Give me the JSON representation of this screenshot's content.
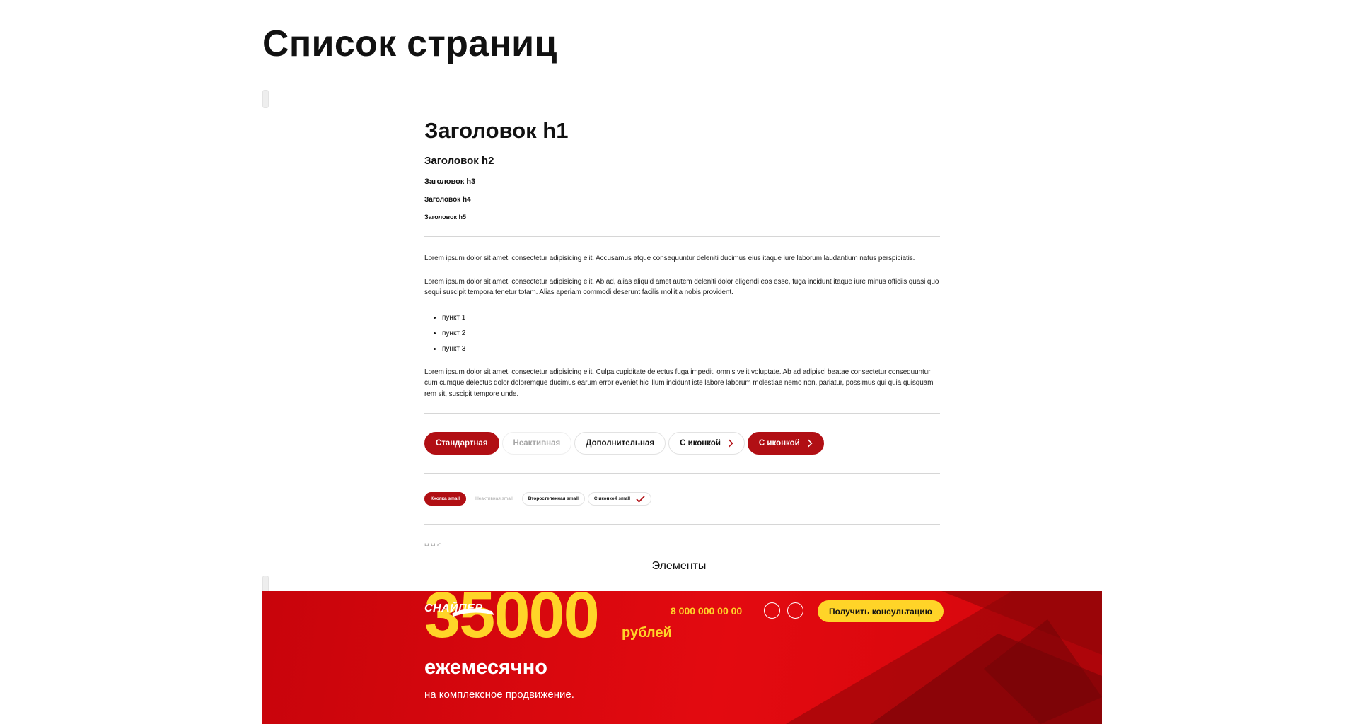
{
  "page": {
    "title": "Список страниц"
  },
  "preview": {
    "h1": "Заголовок h1",
    "h2": "Заголовок h2",
    "h3": "Заголовок h3",
    "h4": "Заголовок h4",
    "h5": "Заголовок h5",
    "paragraph_1": "Lorem ipsum dolor sit amet, consectetur adipisicing elit. Accusamus atque consequuntur deleniti ducimus eius itaque iure laborum laudantium natus perspiciatis.",
    "paragraph_2": "Lorem ipsum dolor sit amet, consectetur adipisicing elit. Ab ad, alias aliquid amet autem deleniti dolor eligendi eos esse, fuga incidunt itaque iure minus officiis quasi quo sequi suscipit tempora tenetur totam. Alias aperiam commodi deserunt facilis mollitia nobis provident.",
    "list": [
      "пункт 1",
      "пункт 2",
      "пункт 3"
    ],
    "paragraph_3": "Lorem ipsum dolor sit amet, consectetur adipisicing elit. Culpa cupiditate delectus fuga impedit, omnis velit voluptate. Ab ad adipisci beatae consectetur consequuntur cum cumque delectus dolor doloremque ducimus earum error eveniet hic illum incidunt iste labore laborum molestiae nemo non, pariatur, possimus qui quia quisquam rem sit, suscipit tempore unde.",
    "buttons": {
      "standard": "Стандартная",
      "inactive": "Неактивная",
      "additional": "Дополнительная",
      "with_icon": "С иконкой",
      "with_icon_primary": "С иконкой"
    },
    "small_buttons": {
      "primary": "Кнопка small",
      "inactive": "Неактивная small",
      "secondary": "Второстепенная small",
      "with_icon": "С иконкой small"
    },
    "faded_text": "Н                 Н                 С"
  },
  "caption": "Элементы",
  "banner": {
    "logo": "СНАЙПЕР",
    "price": "35000",
    "currency": "рублей",
    "phone": "8 000 000 00 00",
    "consult_button": "Получить консультацию",
    "monthly": "ежемесячно",
    "subline": "на комплексное продвижение."
  },
  "colors": {
    "accent": "#b10f14",
    "banner_red": "#e30a10",
    "yellow": "#ffd428"
  }
}
